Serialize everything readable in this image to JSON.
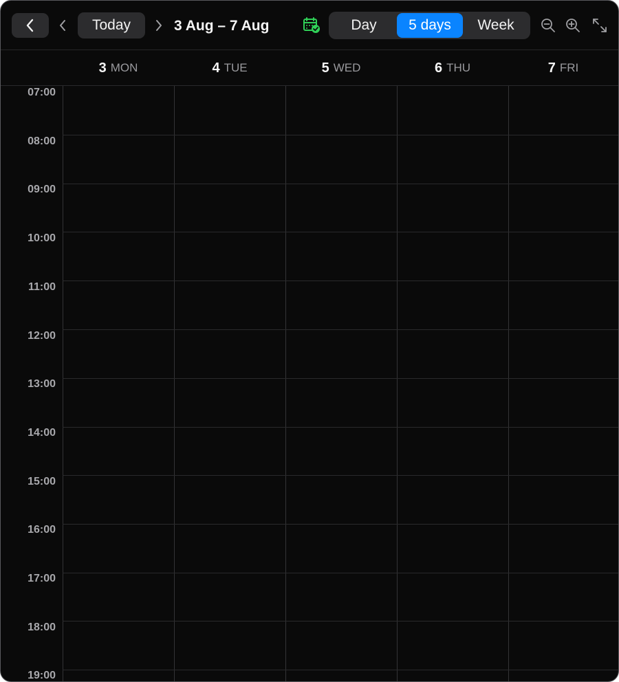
{
  "toolbar": {
    "back_icon": "chevron-left-icon",
    "prev_icon": "chevron-left-icon",
    "today_label": "Today",
    "next_icon": "chevron-right-icon",
    "range_title": "3 Aug – 7 Aug",
    "calendar_icon": "calendar-check-icon",
    "view_modes": [
      {
        "label": "Day",
        "selected": false
      },
      {
        "label": "5 days",
        "selected": true
      },
      {
        "label": "Week",
        "selected": false
      }
    ],
    "zoom_out_icon": "zoom-out-icon",
    "zoom_in_icon": "zoom-in-icon",
    "expand_icon": "expand-icon"
  },
  "days": [
    {
      "num": "3",
      "name": "MON"
    },
    {
      "num": "4",
      "name": "TUE"
    },
    {
      "num": "5",
      "name": "WED"
    },
    {
      "num": "6",
      "name": "THU"
    },
    {
      "num": "7",
      "name": "FRI"
    }
  ],
  "hours": [
    "07:00",
    "08:00",
    "09:00",
    "10:00",
    "11:00",
    "12:00",
    "13:00",
    "14:00",
    "15:00",
    "16:00",
    "17:00",
    "18:00",
    "19:00"
  ],
  "colors": {
    "accent": "#0a84ff",
    "background": "#0a0a0a",
    "calendar_icon": "#30d158"
  }
}
